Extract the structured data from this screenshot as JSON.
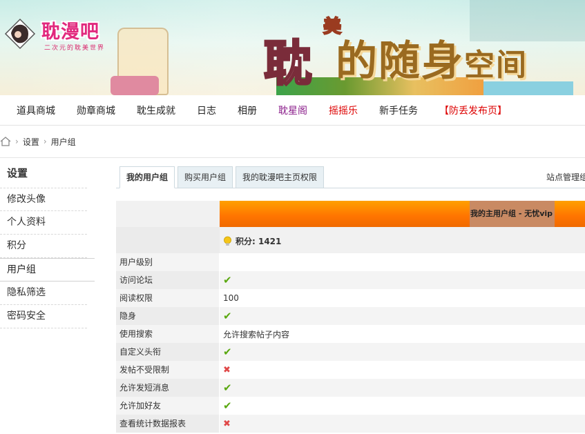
{
  "banner": {
    "logo_text": "耽漫吧",
    "logo_sub": "二次元的耽美世界",
    "title_first": "耽",
    "title_sup": "美",
    "title_rest": "的随身",
    "title_small": "空间"
  },
  "nav": [
    "道具商城",
    "勋章商城",
    "耽生成就",
    "日志",
    "相册",
    "耽星阁",
    "摇摇乐",
    "新手任务",
    "【防丢发布页】"
  ],
  "breadcrumb": {
    "item1": "设置",
    "item2": "用户组"
  },
  "sidebar": {
    "title": "设置",
    "items": [
      "修改头像",
      "个人资料",
      "积分",
      "用户组",
      "隐私筛选",
      "密码安全"
    ]
  },
  "tabs": [
    "我的用户组",
    "购买用户组",
    "我的耽漫吧主页权限"
  ],
  "site_admin": "站点管理组",
  "group_label": "我的主用户组 - 无忧vip",
  "points": "积分: 1421",
  "permissions": [
    {
      "label": "用户级别",
      "value": "",
      "status": ""
    },
    {
      "label": "访问论坛",
      "value": "",
      "status": "yes"
    },
    {
      "label": "阅读权限",
      "value": "100",
      "status": ""
    },
    {
      "label": "隐身",
      "value": "",
      "status": "yes"
    },
    {
      "label": "使用搜索",
      "value": "允许搜索帖子内容",
      "status": ""
    },
    {
      "label": "自定义头衔",
      "value": "",
      "status": "yes"
    },
    {
      "label": "发帖不受限制",
      "value": "",
      "status": "no"
    },
    {
      "label": "允许发短消息",
      "value": "",
      "status": "yes"
    },
    {
      "label": "允许加好友",
      "value": "",
      "status": "yes"
    },
    {
      "label": "查看统计数据报表",
      "value": "",
      "status": "no"
    }
  ],
  "icons": {
    "check": "✔",
    "cross": "✖"
  },
  "colors": {
    "accent": "#ff7400",
    "purple_link": "#8a1c8a",
    "red_link": "#dd0000",
    "ok": "#5aa810",
    "no": "#e04848"
  }
}
